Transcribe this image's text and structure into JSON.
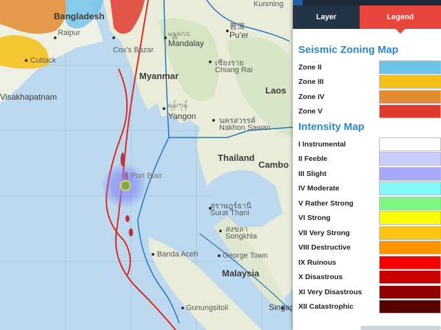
{
  "map": {
    "countries": [
      "Bangladesh",
      "Myanmar",
      "Laos",
      "Thailand",
      "Cambo",
      "Malaysia"
    ],
    "cities": {
      "kunming": "Kunming",
      "raipur": "Raipur",
      "coxs_bazar": "Cox's Bazar",
      "cuttack": "Cuttack",
      "mandalay_local": "မန္တလေး",
      "mandalay": "Mandalay",
      "puer_local": "普洱",
      "puer": "Pu'er",
      "chiangmai_local": "เชียงราย",
      "chiangrai": "Chiang Rai",
      "visakhapatnam": "Visakhapatnam",
      "yangon_local": "ရန်ကုန်",
      "yangon": "Yangon",
      "nakhonsawan_local": "นครสวรรค์",
      "nakhonsawan": "Nakhon Sawan",
      "portblair": "Port Blair",
      "suratthani_local": "สุราษฎร์ธานี",
      "suratthani": "Surat Thani",
      "songkhla_local": "สงขลา",
      "songkhla": "Songkhla",
      "bandaaceh": "Banda Aceh",
      "georgetown": "George Town",
      "gunungsitoli": "Gunungsitoli",
      "singapore": "Singap"
    }
  },
  "tabs": {
    "layer": "Layer",
    "legend": "Legend"
  },
  "legend": {
    "seismic_title": "Seismic Zoning Map",
    "seismic_zones": [
      {
        "label": "Zone II",
        "color": "#6ec3ea"
      },
      {
        "label": "Zone III",
        "color": "#f5c013"
      },
      {
        "label": "Zone IV",
        "color": "#e38b2e"
      },
      {
        "label": "Zone V",
        "color": "#e2392f"
      }
    ],
    "intensity_title": "Intensity Map",
    "intensity_levels": [
      {
        "label": "I Instrumental",
        "color": "#ffffff"
      },
      {
        "label": "II Feeble",
        "color": "#c8cdfd"
      },
      {
        "label": "III Slight",
        "color": "#a5a8fb"
      },
      {
        "label": "IV Moderate",
        "color": "#85f9f9"
      },
      {
        "label": "V Rather Strong",
        "color": "#7ff883"
      },
      {
        "label": "VI Strong",
        "color": "#fcfc04"
      },
      {
        "label": "VII Very Strong",
        "color": "#fcc610"
      },
      {
        "label": "VIII Destructive",
        "color": "#fc9302"
      },
      {
        "label": "IX Ruinous",
        "color": "#fb0000"
      },
      {
        "label": "X Disastrous",
        "color": "#cb0000"
      },
      {
        "label": "XI Very Disastrous",
        "color": "#900000"
      },
      {
        "label": "XII Catastrophic",
        "color": "#560000"
      }
    ]
  }
}
